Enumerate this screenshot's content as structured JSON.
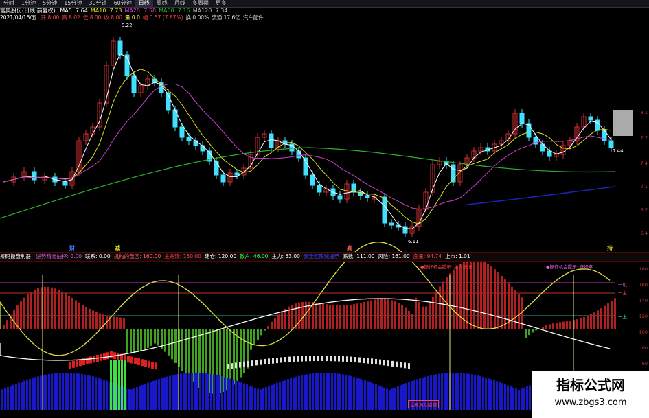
{
  "tabs": [
    "分时",
    "1分钟",
    "5分钟",
    "15分钟",
    "30分钟",
    "60分钟",
    "日线",
    "周线",
    "月线",
    "多周期",
    "更多"
  ],
  "active_tab": 6,
  "stock": {
    "name": "富奥股份(日线 前复权)",
    "ma": [
      {
        "label": "MA5: 7.64",
        "color": "#ffffff"
      },
      {
        "label": "MA10: 7.73",
        "color": "#e0e020"
      },
      {
        "label": "MA20: 7.58",
        "color": "#e040e0"
      },
      {
        "label": "MA60: 7.16",
        "color": "#20c020"
      },
      {
        "label": "MA120: 7.34",
        "color": "#c0c0c0"
      }
    ],
    "date": "2021/04/16/五",
    "quote": [
      {
        "label": "开 8.00",
        "color": "#ff4040"
      },
      {
        "label": "高 8.02",
        "color": "#ff4040"
      },
      {
        "label": "低 8.00",
        "color": "#ff4040"
      },
      {
        "label": "收 8.00",
        "color": "#ff4040"
      },
      {
        "label": "量 0.0",
        "color": "#ffff40"
      },
      {
        "label": "幅 0.57 (7.67%)",
        "color": "#ff4040"
      },
      {
        "label": "换 0.00%",
        "color": "#dddddd"
      },
      {
        "label": "流通 17.6亿",
        "color": "#dddddd"
      },
      {
        "label": "汽车配件",
        "color": "#dddddd"
      }
    ],
    "high_label": "9.22",
    "low_label": "6.11",
    "current_price": "7.44"
  },
  "markers": [
    {
      "text": "财",
      "color": "#4080ff"
    },
    {
      "text": "减",
      "color": "#e0e020"
    },
    {
      "text": "高",
      "color": "#ff6060"
    },
    {
      "text": "持",
      "color": "#e0e020"
    }
  ],
  "indicator": {
    "name": "筹码操盘利器",
    "params": [
      {
        "label": "逆势精准抽杯: 0.00",
        "color": "#d060d0"
      },
      {
        "label": "联系: 0.00",
        "color": "#ffffff"
      },
      {
        "label": "机构的盘区: 160.00",
        "color": "#ff6060"
      },
      {
        "label": "主升浪: 150.00",
        "color": "#ff4040"
      },
      {
        "label": "建仓: 120.00",
        "color": "#ffffff"
      },
      {
        "label": "散户: 46.00",
        "color": "#40ff40"
      },
      {
        "label": "主力: 53.00",
        "color": "#ffffff"
      },
      {
        "label": "安全区阳线提示",
        "color": "#4040ff"
      },
      {
        "label": "系数: 111.00",
        "color": "#ffffff"
      },
      {
        "label": "风险: 161.00",
        "color": "#ffffff"
      },
      {
        "label": "庄量: 94.74",
        "color": "#ff4040"
      },
      {
        "label": "上市: 1.01",
        "color": "#ffffff"
      }
    ],
    "note_left": "●操作机会提示: 主力进场",
    "note_right": "●操作机会提示: 选择拿",
    "note_bottom": "注意风险回避",
    "line_tags": [
      "一机",
      "一主",
      "一上"
    ]
  },
  "axis_right_top": [
    "8.1",
    "7.7",
    "7.4",
    "7.1",
    "6.7",
    "6.4"
  ],
  "axis_right_bottom": [
    "180",
    "160",
    "140",
    "120",
    "100",
    "80",
    "60",
    "40"
  ],
  "watermark": {
    "title": "指标公式网",
    "url": "www.zbgs3.com"
  },
  "colors": {
    "up": "#d03030",
    "down": "#40e0ff",
    "ma5": "#ffffff",
    "ma10": "#e0e020",
    "ma20": "#d040d0",
    "ma60": "#30b030",
    "ma120": "#2020c0"
  }
}
